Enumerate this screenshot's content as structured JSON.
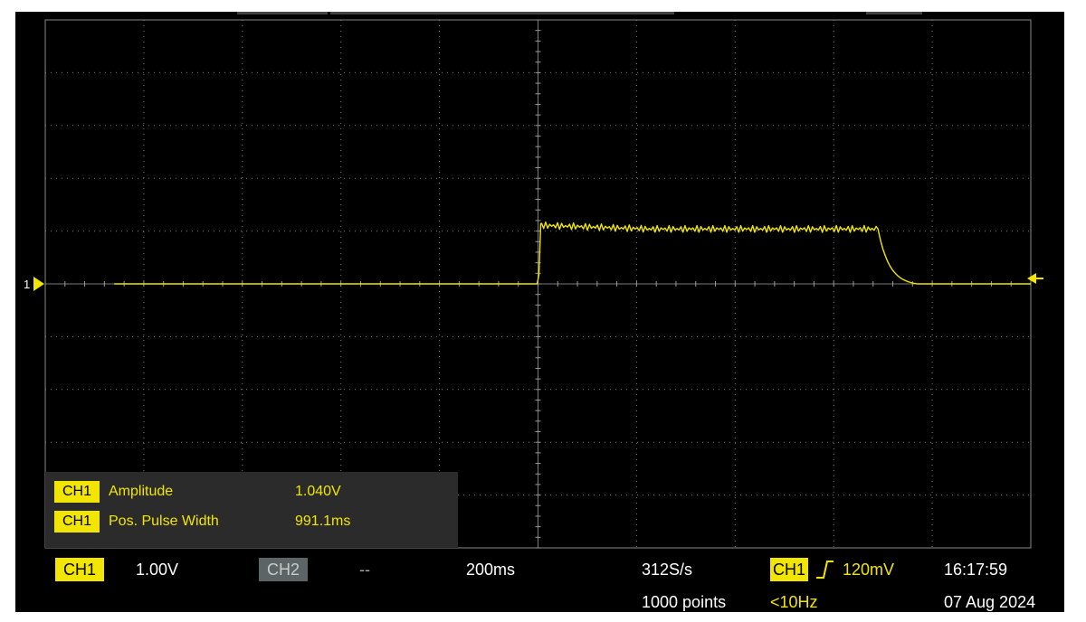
{
  "colors": {
    "trace": "#f2e600",
    "background": "#000000",
    "grid": "#7a7a7a",
    "panel": "#2b2b2b",
    "ch2_tag": "#5d6465"
  },
  "trace": {
    "channel": "1",
    "ground_marker": "1",
    "baseline_v": 0.0,
    "pulse_high_v": 1.04,
    "pulse_rise_div": 5.0,
    "pulse_fall_start_div": 8.45,
    "fall_end_div": 8.85,
    "trace_start_div": 0.7,
    "volts_per_div": 1.0
  },
  "measurements": [
    {
      "channel": "CH1",
      "label": "Amplitude",
      "value": "1.040V"
    },
    {
      "channel": "CH1",
      "label": "Pos. Pulse Width",
      "value": "991.1ms"
    }
  ],
  "status_bar": {
    "ch1_tag": "CH1",
    "ch1_scale": "1.00V",
    "ch2_tag": "CH2",
    "ch2_scale": "--",
    "timebase": "200ms",
    "sample_rate": "312S/s",
    "record_length": "1000 points",
    "trigger_source": "CH1",
    "trigger_slope_icon": "rising-edge-icon",
    "trigger_level": "120mV",
    "trigger_freq": "<10Hz",
    "time": "16:17:59",
    "date": "07 Aug 2024"
  }
}
